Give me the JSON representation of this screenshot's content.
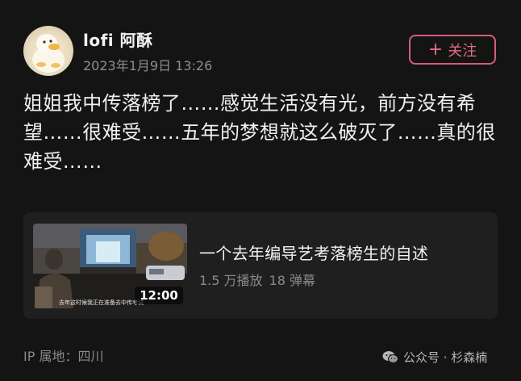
{
  "user": {
    "name": "lofi 阿酥",
    "timestamp": "2023年1月9日 13:26",
    "avatar_icon": "duck-avatar-icon"
  },
  "follow_button": {
    "icon": "plus-icon",
    "plus": "+",
    "label": "关注"
  },
  "post": {
    "text": "姐姐我中传落榜了……感觉生活没有光，前方没有希望……很难受……五年的梦想就这么破灭了……真的很难受……"
  },
  "video": {
    "title": "一个去年编导艺考落榜生的自述",
    "plays": "1.5 万播放",
    "danmaku": "18 弹幕",
    "duration": "12:00",
    "subtitle": "去年这时候我正在准备去中传考试"
  },
  "ip_location": "IP 属地：四川",
  "watermark": {
    "icon": "wechat-icon",
    "text": "公众号 · 杉森楠"
  },
  "colors": {
    "background": "#141414",
    "card": "#1f1f1f",
    "accent": "#e36a87",
    "muted": "#8a8a8a"
  }
}
